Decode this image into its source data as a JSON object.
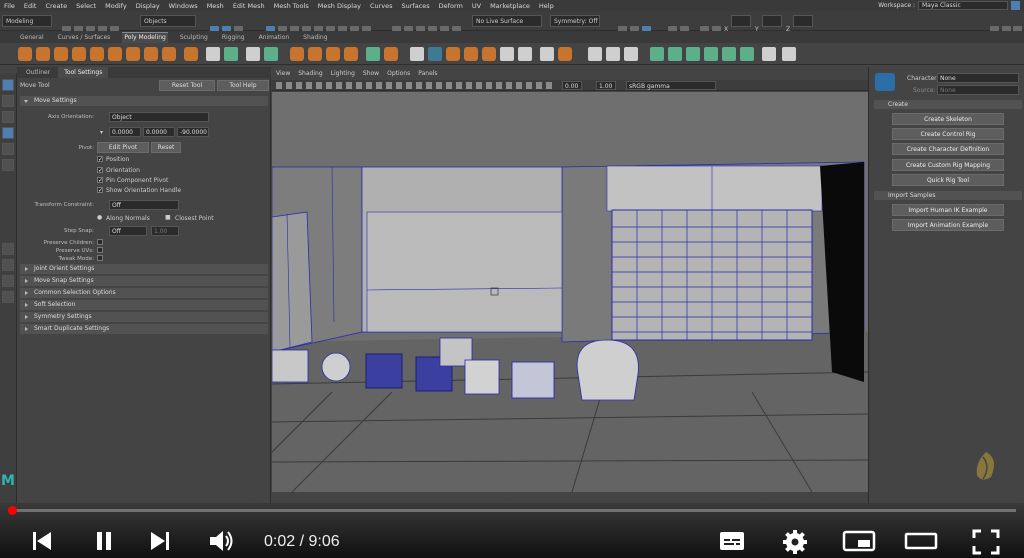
{
  "menubar": {
    "items": [
      "File",
      "Edit",
      "Create",
      "Select",
      "Modify",
      "Display",
      "Windows",
      "Mesh",
      "Edit Mesh",
      "Mesh Tools",
      "Mesh Display",
      "Curves",
      "Surfaces",
      "Deform",
      "UV",
      "Marketplace",
      "Help"
    ],
    "workspace_label": "Workspace :",
    "workspace_value": "Maya Classic"
  },
  "statusline": {
    "mode": "Modeling",
    "objects": "Objects",
    "live_surface": "No Live Surface",
    "symmetry": "Symmetry: Off",
    "x": "X",
    "y": "Y",
    "z": "Z"
  },
  "shelf_tabs": [
    "General",
    "Curves / Surfaces",
    "Poly Modeling",
    "Sculpting",
    "Rigging",
    "Animation",
    "Shading"
  ],
  "shelf_active": "Poly Modeling",
  "left_panel": {
    "tabs": [
      "Outliner",
      "Tool Settings"
    ],
    "active_tab": "Tool Settings",
    "tool_name": "Move Tool",
    "reset_tool": "Reset Tool",
    "tool_help": "Tool Help",
    "move_settings": "Move Settings",
    "axis_orientation_label": "Axis Orientation:",
    "axis_orientation_value": "Object",
    "vals": [
      "0.0000",
      "0.0000",
      "-90.0000"
    ],
    "pivot_label": "Pivot:",
    "edit_pivot": "Edit Pivot",
    "reset": "Reset",
    "checks": [
      "Position",
      "Orientation",
      "Pin Component Pivot",
      "Show Orientation Handle"
    ],
    "transform_constraint_label": "Transform Constraint:",
    "transform_constraint_value": "Off",
    "along_normals": "Along Normals",
    "closest_point": "Closest Point",
    "step_snap_label": "Step Snap:",
    "step_snap_value": "Off",
    "step_snap_num": "1.00",
    "preserve_children": "Preserve Children:",
    "preserve_uvs": "Preserve UVs:",
    "tweak_mode": "Tweak Mode:",
    "sections": [
      "Joint Orient Settings",
      "Move Snap Settings",
      "Common Selection Options",
      "Soft Selection",
      "Symmetry Settings",
      "Smart Duplicate Settings"
    ]
  },
  "viewport": {
    "menu": [
      "View",
      "Shading",
      "Lighting",
      "Show",
      "Options",
      "Panels"
    ],
    "field1": "0.00",
    "field2": "1.00",
    "colorspace": "sRGB gamma"
  },
  "right_panel": {
    "character_label": "Character:",
    "character_value": "None",
    "source_label": "Source:",
    "source_value": "None",
    "create_header": "Create",
    "create_buttons": [
      "Create Skeleton",
      "Create Control Rig",
      "Create Character Definition",
      "Create Custom Rig Mapping",
      "Quick Rig Tool"
    ],
    "import_header": "Import Samples",
    "import_buttons": [
      "Import Human IK Example",
      "Import Animation Example"
    ]
  },
  "player": {
    "time": "0:02 / 9:06",
    "progress": 0.004
  },
  "colors": {
    "accent_blue": "#4d7fb0",
    "progress_red": "#ff0000",
    "wire": "#2a2ab0"
  },
  "icons": [
    "skip-back-icon",
    "pause-icon",
    "skip-next-icon",
    "volume-icon",
    "subtitles-icon",
    "settings-icon",
    "miniplayer-icon",
    "theater-icon",
    "fullscreen-icon"
  ]
}
